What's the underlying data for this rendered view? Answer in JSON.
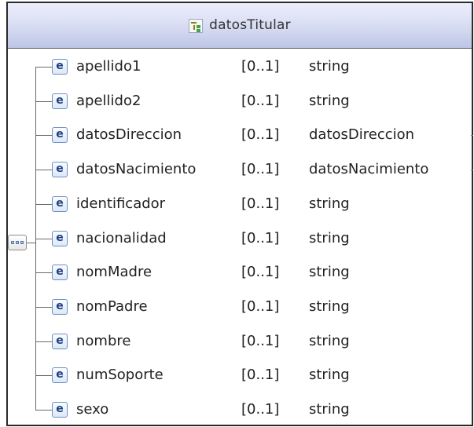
{
  "header": {
    "title": "datosTitular",
    "icon": "complex-type-icon"
  },
  "sequence": {
    "icon": "sequence-icon"
  },
  "elements": [
    {
      "name": "apellido1",
      "cardinality": "[0..1]",
      "type": "string"
    },
    {
      "name": "apellido2",
      "cardinality": "[0..1]",
      "type": "string"
    },
    {
      "name": "datosDireccion",
      "cardinality": "[0..1]",
      "type": "datosDireccion"
    },
    {
      "name": "datosNacimiento",
      "cardinality": "[0..1]",
      "type": "datosNacimiento"
    },
    {
      "name": "identificador",
      "cardinality": "[0..1]",
      "type": "string"
    },
    {
      "name": "nacionalidad",
      "cardinality": "[0..1]",
      "type": "string"
    },
    {
      "name": "nomMadre",
      "cardinality": "[0..1]",
      "type": "string"
    },
    {
      "name": "nomPadre",
      "cardinality": "[0..1]",
      "type": "string"
    },
    {
      "name": "nombre",
      "cardinality": "[0..1]",
      "type": "string"
    },
    {
      "name": "numSoporte",
      "cardinality": "[0..1]",
      "type": "string"
    },
    {
      "name": "sexo",
      "cardinality": "[0..1]",
      "type": "string"
    }
  ],
  "element_icon_glyph": "e"
}
